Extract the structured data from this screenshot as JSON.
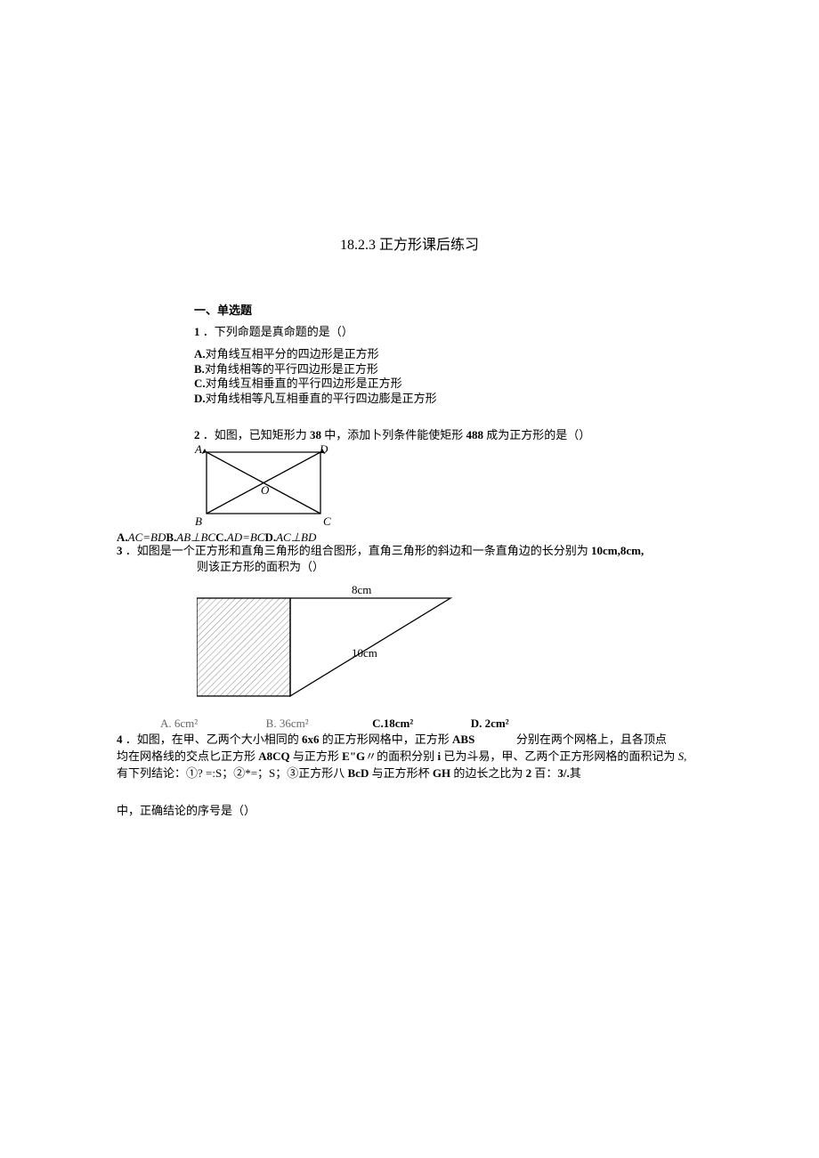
{
  "title": "18.2.3 正方形课后练习",
  "section": "一、单选题",
  "q1": {
    "num": "1",
    "stem": "．下列命题是真命题的是（）",
    "A": "A.对角线互相平分的四边形是正方形",
    "B": "B.对角线相等的平行四边形是正方形",
    "C": "C.对角线互相垂直的平行四边形是正方形",
    "D": "D.对角线相等凡互相垂直的平行四边膨是正方形"
  },
  "q2": {
    "num": "2",
    "stem": "．如图，已知矩形力 38 中，添加卜列条件能使矩形 488 成为正方形的是（）",
    "A_lead": "A.",
    "A": "AC=BD",
    "B_lead": "B.",
    "B": "AB⊥BC",
    "C_lead": "C.",
    "C": "AD=BC",
    "D_lead": "D.",
    "D": "AC⊥BD",
    "labelA": "A",
    "labelB": "B",
    "labelC": "C",
    "labelD": "D",
    "labelO": "O"
  },
  "q3": {
    "num": "3",
    "stem1": "．如图是一个正方形和直角三角形的组合图形，直角三角形的斜边和一条直角边的长分别为 10cm,8cm,",
    "stem2": "则该正方形的面积为（）",
    "lbl8": "8cm",
    "lbl10": "10cm",
    "A": "A. 6cm²",
    "B": "B. 36cm²",
    "C_lead": "C.",
    "C": "18cm²",
    "D": "D. 2cm²"
  },
  "q4": {
    "num": "4",
    "stem1": "．如图，在甲、乙两个大小相同的 6x6 的正方形网格中，正方形 ABS",
    "stem2": "分别在两个网格上，且各顶点",
    "stem3": "均在网格线的交点匕正方形 A8CQ 与正方形 E\"G〃的面积分别 i 已为斗易，甲、乙两个正方形网格的面积记为 S,",
    "stem4": "有下列结论：①? =:S；②*=；S；③正方形八 BcD 与正方形杯 GH 的边长之比为 2 百：3/.其",
    "tail": "中，正确结论的序号是（）"
  }
}
